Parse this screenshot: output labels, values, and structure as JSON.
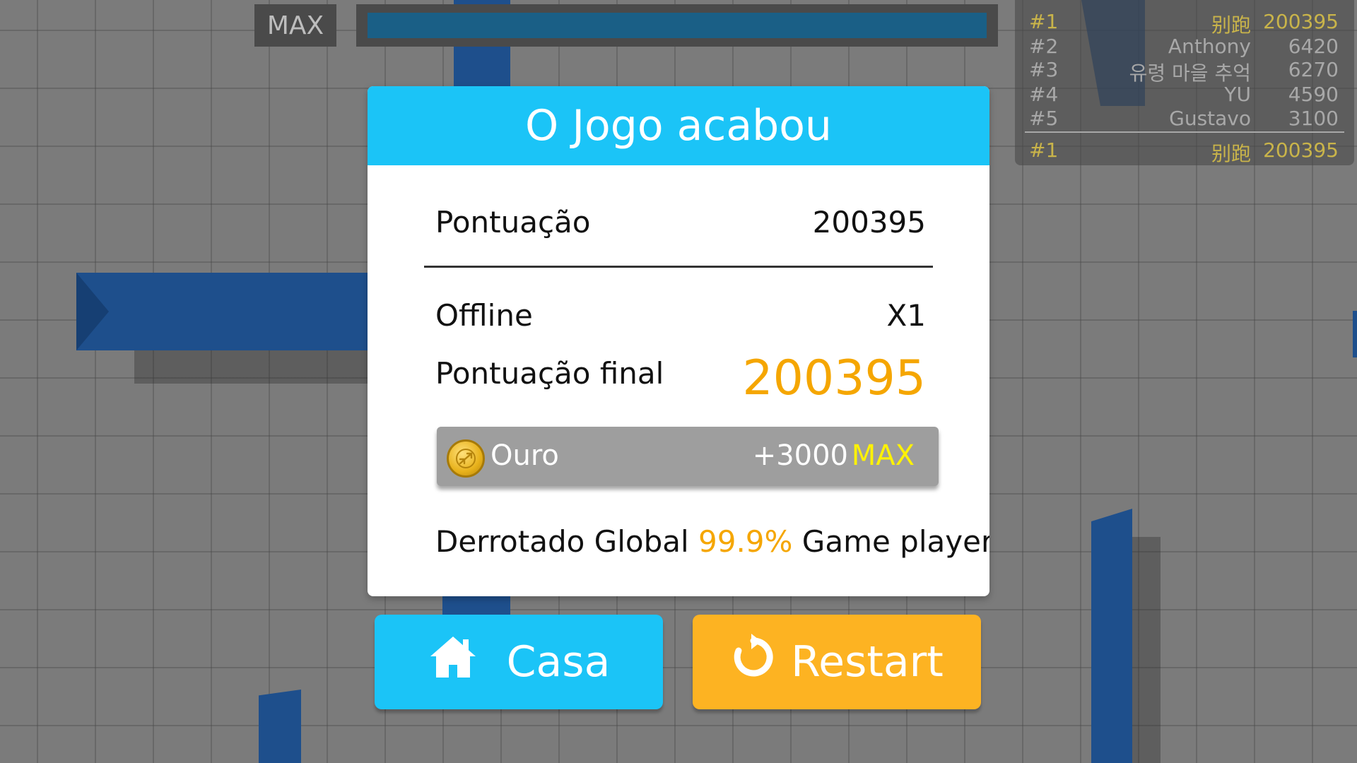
{
  "hud": {
    "max_label": "MAX",
    "progress": 1.0,
    "progress_color": "#1a5f86"
  },
  "leaderboard": {
    "rows": [
      {
        "rank": "#1",
        "name": "别跑",
        "score": "200395"
      },
      {
        "rank": "#2",
        "name": "Anthony",
        "score": "6420"
      },
      {
        "rank": "#3",
        "name": "유령 마을 추억",
        "score": "6270"
      },
      {
        "rank": "#4",
        "name": "YU",
        "score": "4590"
      },
      {
        "rank": "#5",
        "name": "Gustavo",
        "score": "3100"
      }
    ],
    "self": {
      "rank": "#1",
      "name": "别跑",
      "score": "200395"
    },
    "highlight_color": "#c9b44a"
  },
  "dialog": {
    "title": "O Jogo acabou",
    "score_label": "Pontuação",
    "score_value": "200395",
    "mode_label": "Offline",
    "mode_value": "X1",
    "final_label": "Pontuação final",
    "final_value": "200395",
    "gold": {
      "icon": "coin-icon",
      "label": "Ouro",
      "amount": "+3000",
      "max": "MAX"
    },
    "defeated_prefix": "Derrotado Global",
    "defeated_percent": "99.9%",
    "defeated_suffix": "Game players",
    "header_color": "#1bc4f7",
    "accent_color": "#f5a600"
  },
  "buttons": {
    "home": {
      "label": "Casa",
      "icon": "home-icon",
      "color": "#1bc4f7"
    },
    "restart": {
      "label": "Restart",
      "icon": "restart-icon",
      "color": "#fdb322"
    }
  }
}
